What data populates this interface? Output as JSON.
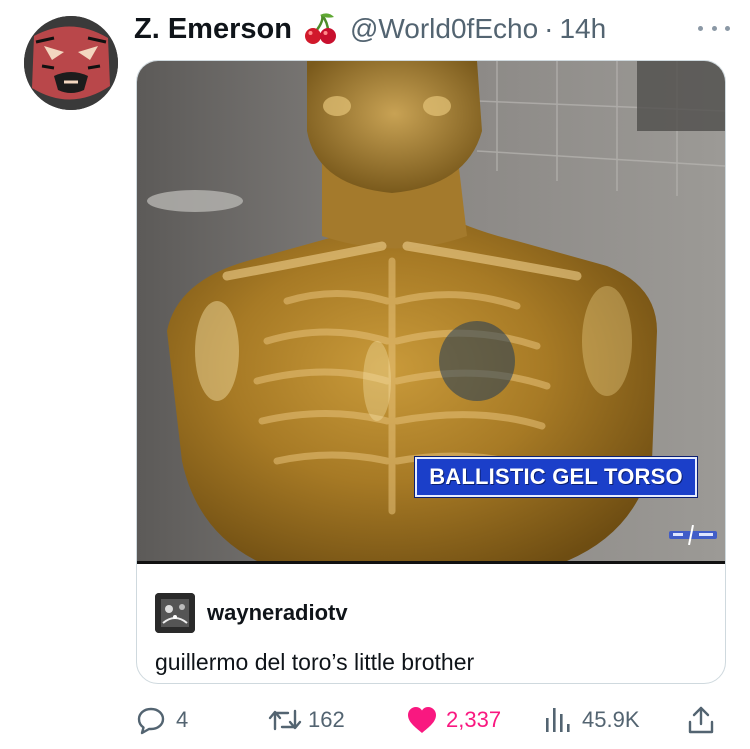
{
  "tweet": {
    "display_name": "Z. Emerson",
    "handle": "@World0fEcho",
    "separator": "·",
    "time": "14h",
    "badge_icon": "cherries-icon",
    "more_icon": "more-dots-icon"
  },
  "media": {
    "chyron": "BALLISTIC GEL TORSO",
    "station_logo_icon": "news-station-logo"
  },
  "quote": {
    "username": "wayneradiotv",
    "text": "guillermo del toro’s little brother"
  },
  "actions": {
    "reply": {
      "icon": "reply-bubble-icon",
      "count": "4"
    },
    "retweet": {
      "icon": "retweet-icon",
      "count": "162"
    },
    "like": {
      "icon": "heart-icon",
      "count": "2,337"
    },
    "views": {
      "icon": "views-bars-icon",
      "count": "45.9K"
    },
    "share": {
      "icon": "share-icon"
    }
  },
  "colors": {
    "text_primary": "#0f1419",
    "text_secondary": "#536471",
    "like_pink": "#f91880",
    "chyron_blue": "#1b3fc9",
    "card_border": "#cfd9de"
  }
}
